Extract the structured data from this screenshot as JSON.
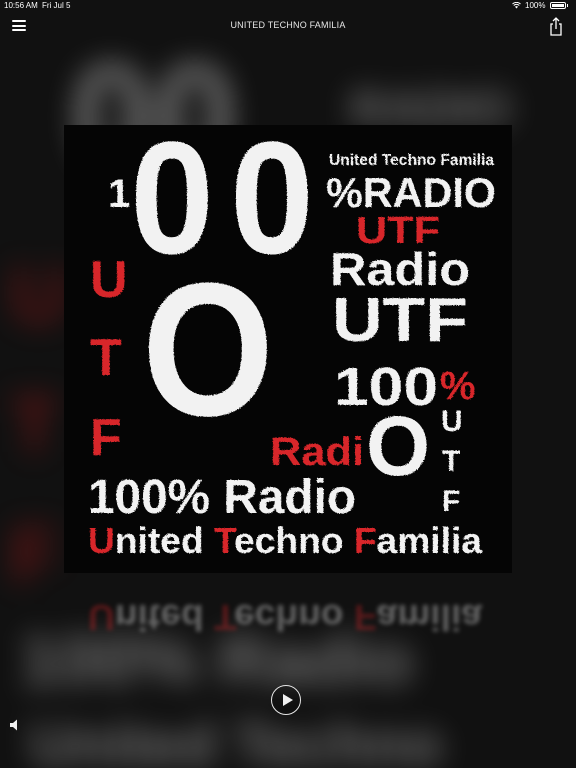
{
  "status_bar": {
    "time": "10:56 AM",
    "date": "Fri Jul 5",
    "battery": "100%"
  },
  "nav": {
    "title": "UNITED TECHNO FAMILIA",
    "menu_icon": "hamburger-menu-icon",
    "share_icon": "share-icon"
  },
  "artwork": {
    "line_united_small": "United Techno Familia",
    "one": "1",
    "zero_a": "0",
    "zero_b": "0",
    "percent_radio": "%RADIO",
    "utf_red": "UTF",
    "radio_mid": "Radio",
    "utf_white": "UTF",
    "hundred": "100",
    "percent": "%",
    "big_o": "O",
    "radi": "Radi",
    "o_small": "O",
    "u_left": "U",
    "t_left": "T",
    "f_left": "F",
    "u_right": "U",
    "t_right": "T",
    "f_right": "F",
    "hundred_radio": "100% Radio",
    "bottom_u": "U",
    "bottom_nited": "nited ",
    "bottom_t": "T",
    "bottom_echno": "echno ",
    "bottom_f": "F",
    "bottom_amilia": "amilia"
  },
  "player": {
    "play_icon": "play-icon",
    "volume_icon": "speaker-icon"
  },
  "colors": {
    "red": "#d8262a",
    "white": "#f2f2f2",
    "background": "#111111"
  }
}
